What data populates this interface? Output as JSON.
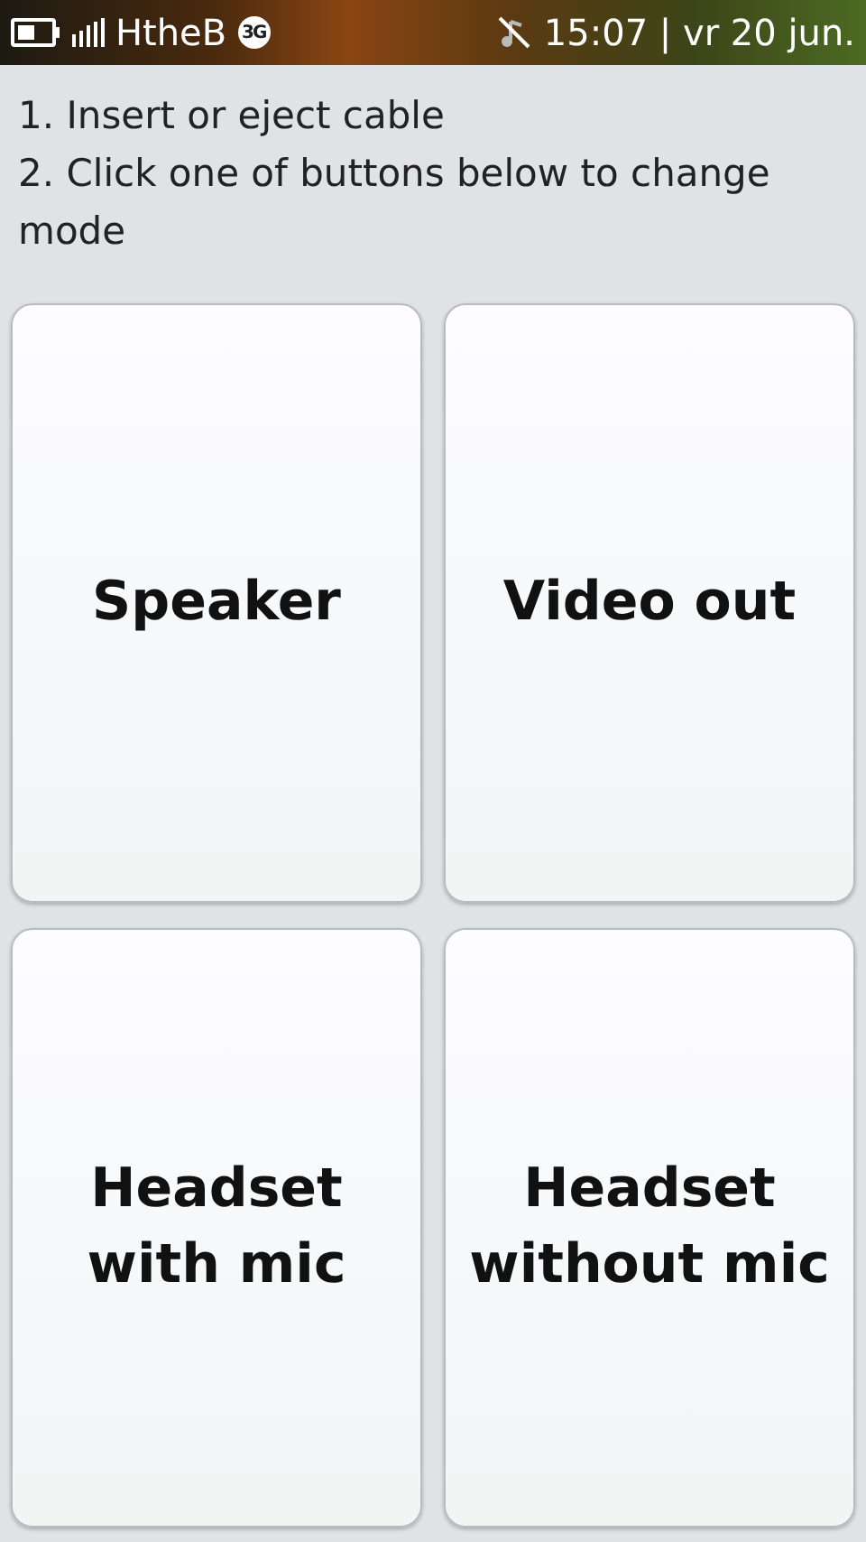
{
  "status_bar": {
    "operator": "HtheB",
    "network": "3G",
    "clock": "15:07 | vr 20 jun."
  },
  "instructions": [
    "1. Insert or eject cable",
    "2. Click one of buttons below to change mode"
  ],
  "buttons": [
    {
      "label": "Speaker"
    },
    {
      "label": "Video out"
    },
    {
      "label": "Headset\nwith mic"
    },
    {
      "label": "Headset\nwithout mic"
    }
  ]
}
